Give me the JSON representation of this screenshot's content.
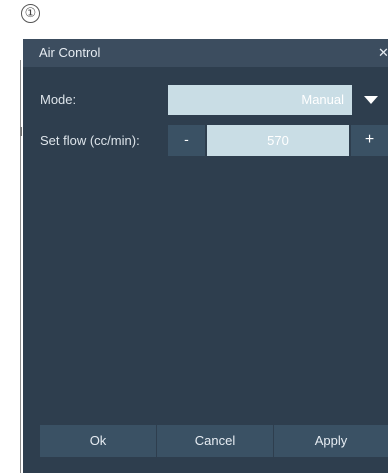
{
  "step_marker": "①",
  "window": {
    "title": "Air Control",
    "close_label": "✕"
  },
  "mode": {
    "label": "Mode:",
    "value": "Manual",
    "dropdown_icon": "chevron-down-icon"
  },
  "flow": {
    "label": "Set flow (cc/min):",
    "value": "570",
    "minus_label": "-",
    "plus_label": "+"
  },
  "footer": {
    "ok_label": "Ok",
    "cancel_label": "Cancel",
    "apply_label": "Apply"
  },
  "colors": {
    "window_background": "#2e3e4e",
    "titlebar": "#3c4d5f",
    "input_background": "#c9dde5",
    "button_background": "#3a5164",
    "text": "#e6ecf2"
  }
}
